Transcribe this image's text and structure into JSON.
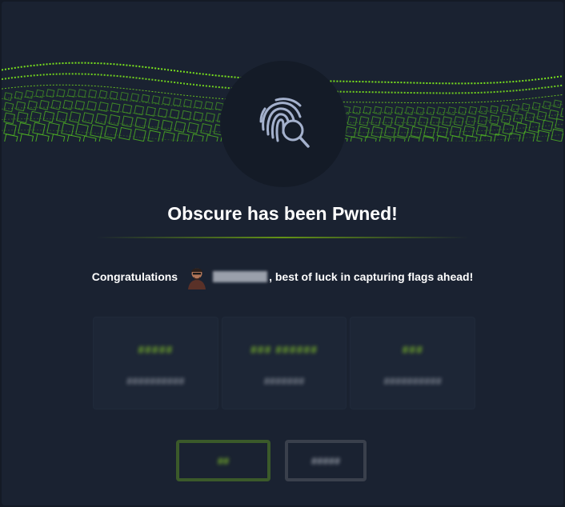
{
  "modal": {
    "title": "Obscure has been Pwned!",
    "congrats_prefix": "Congratulations",
    "congrats_suffix": ", best of luck in capturing flags ahead!",
    "icon": "fingerprint-search-icon",
    "banner": "green-voxel-wave-banner",
    "avatar": "user-avatar"
  },
  "stats": [
    {
      "value": "#####",
      "label": "##########"
    },
    {
      "value": "### ######",
      "label": "#######"
    },
    {
      "value": "###",
      "label": "##########"
    }
  ],
  "buttons": {
    "primary_label": "##",
    "secondary_label": "#####"
  },
  "colors": {
    "accent": "#9fef00",
    "background": "#1a2231",
    "badge": "#141b27",
    "icon_stroke": "#a4b1cd"
  }
}
